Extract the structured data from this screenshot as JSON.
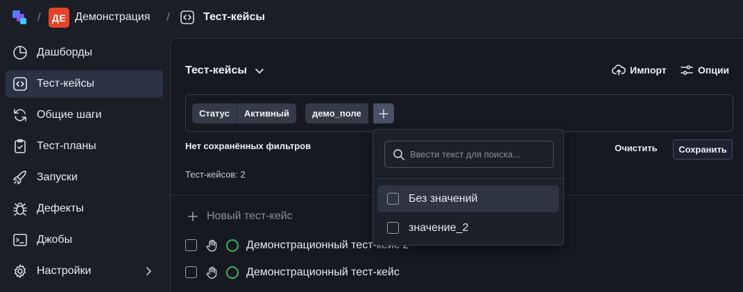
{
  "colors": {
    "background": "#1b1e27",
    "panel": "#161922",
    "active_nav": "#2b3244",
    "project_badge": "#e5442c",
    "status_ok": "#3fb35c"
  },
  "breadcrumb": {
    "separator": "/",
    "project_badge": "ДЕ",
    "project_name": "Демонстрация",
    "page": "Тест-кейсы"
  },
  "sidebar": {
    "items": [
      {
        "label": "Дашборды",
        "icon": "pie-chart-icon"
      },
      {
        "label": "Тест-кейсы",
        "icon": "code-icon",
        "active": true
      },
      {
        "label": "Общие шаги",
        "icon": "refresh-icon"
      },
      {
        "label": "Тест-планы",
        "icon": "clipboard-check-icon"
      },
      {
        "label": "Запуски",
        "icon": "rocket-icon"
      },
      {
        "label": "Дефекты",
        "icon": "bug-icon"
      },
      {
        "label": "Джобы",
        "icon": "terminal-icon"
      },
      {
        "label": "Настройки",
        "icon": "gear-icon"
      }
    ]
  },
  "main": {
    "title": "Тест-кейсы",
    "import_label": "Импорт",
    "options_label": "Опции",
    "filter": {
      "status_label": "Статус",
      "status_value": "Активный",
      "custom_field": "демо_поле",
      "add_symbol": "+"
    },
    "no_saved_filters": "Нет сохранённых фильтров",
    "clear_label": "Очистить",
    "save_label": "Сохранить",
    "count_text": "Тест-кейсов: 2",
    "new_testcase_label": "Новый тест-кейс",
    "new_testcase_symbol": "+",
    "rows": [
      {
        "name": "Демонстрационный тест-кейс 2"
      },
      {
        "name": "Демонстрационный тест-кейс"
      }
    ]
  },
  "dropdown": {
    "search_placeholder": "Ввести текст для поиска...",
    "options": [
      {
        "label": "Без значений",
        "checked": false
      },
      {
        "label": "значение_2",
        "checked": false
      }
    ]
  }
}
